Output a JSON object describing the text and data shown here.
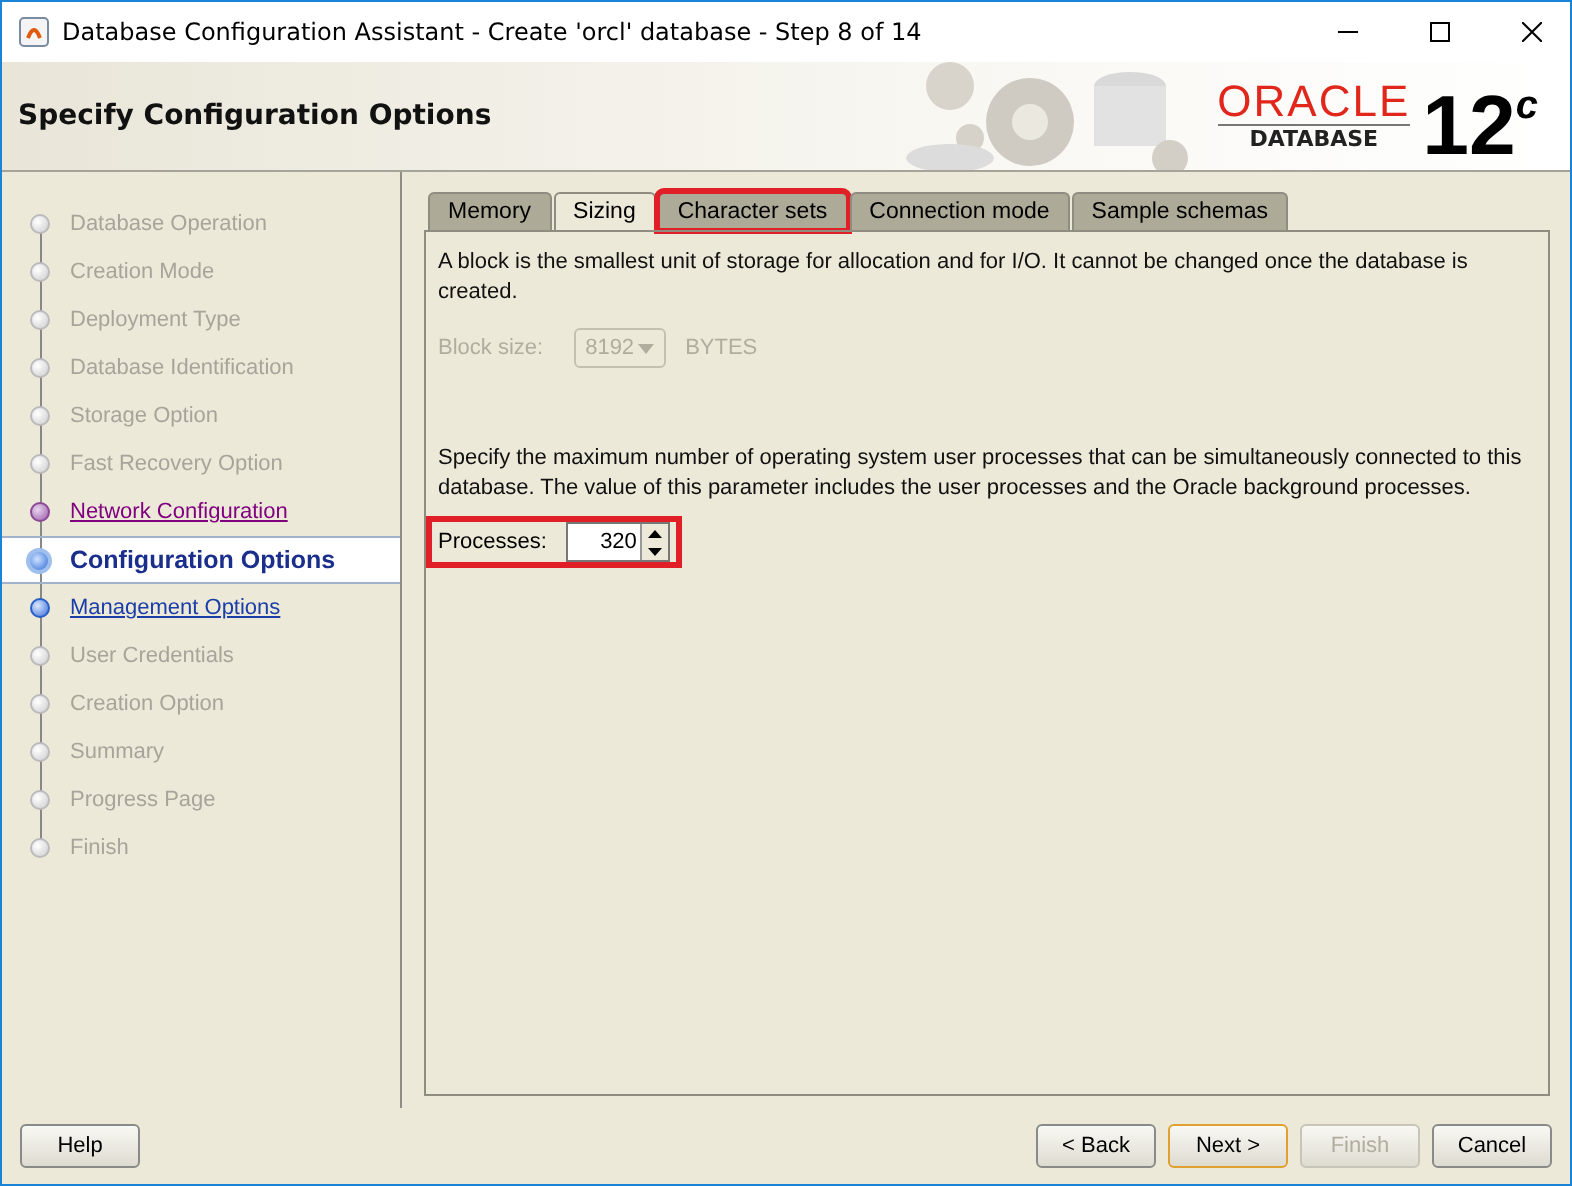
{
  "window": {
    "title": "Database Configuration Assistant - Create 'orcl' database - Step 8 of 14"
  },
  "header": {
    "title": "Specify Configuration Options",
    "brand": "ORACLE",
    "product": "DATABASE",
    "version": "12",
    "version_sup": "c"
  },
  "steps": [
    {
      "label": "Database Operation",
      "enabled": false,
      "visited": false,
      "selected": false
    },
    {
      "label": "Creation Mode",
      "enabled": false,
      "visited": false,
      "selected": false
    },
    {
      "label": "Deployment Type",
      "enabled": false,
      "visited": false,
      "selected": false
    },
    {
      "label": "Database Identification",
      "enabled": false,
      "visited": false,
      "selected": false
    },
    {
      "label": "Storage Option",
      "enabled": false,
      "visited": false,
      "selected": false
    },
    {
      "label": "Fast Recovery Option",
      "enabled": false,
      "visited": false,
      "selected": false
    },
    {
      "label": "Network Configuration",
      "enabled": true,
      "visited": true,
      "selected": false
    },
    {
      "label": "Configuration Options",
      "enabled": true,
      "visited": false,
      "selected": true
    },
    {
      "label": "Management Options",
      "enabled": true,
      "visited": false,
      "selected": false
    },
    {
      "label": "User Credentials",
      "enabled": false,
      "visited": false,
      "selected": false
    },
    {
      "label": "Creation Option",
      "enabled": false,
      "visited": false,
      "selected": false
    },
    {
      "label": "Summary",
      "enabled": false,
      "visited": false,
      "selected": false
    },
    {
      "label": "Progress Page",
      "enabled": false,
      "visited": false,
      "selected": false
    },
    {
      "label": "Finish",
      "enabled": false,
      "visited": false,
      "selected": false
    }
  ],
  "tabs": [
    {
      "label": "Memory",
      "selected": false,
      "highlighted": false
    },
    {
      "label": "Sizing",
      "selected": true,
      "highlighted": false
    },
    {
      "label": "Character sets",
      "selected": false,
      "highlighted": true
    },
    {
      "label": "Connection mode",
      "selected": false,
      "highlighted": false
    },
    {
      "label": "Sample schemas",
      "selected": false,
      "highlighted": false
    }
  ],
  "block_text": "A block is the smallest unit of storage for allocation and for I/O. It cannot be changed once the database is created.",
  "block_size": {
    "label": "Block size:",
    "value": "8192",
    "unit": "BYTES",
    "disabled": true
  },
  "processes_text": "Specify the maximum number of operating system user processes that can be simultaneously connected to this database. The value of this parameter includes the user processes and the Oracle background processes.",
  "processes": {
    "label": "Processes:",
    "value": "320",
    "highlighted": true
  },
  "buttons": [
    {
      "label": "Help",
      "kind": "help",
      "disabled": false,
      "default": false
    },
    {
      "label": "< Back",
      "kind": "nav",
      "disabled": false,
      "default": false
    },
    {
      "label": "Next >",
      "kind": "nav",
      "disabled": false,
      "default": true
    },
    {
      "label": "Finish",
      "kind": "nav",
      "disabled": true,
      "default": false
    },
    {
      "label": "Cancel",
      "kind": "nav",
      "disabled": false,
      "default": false
    }
  ]
}
